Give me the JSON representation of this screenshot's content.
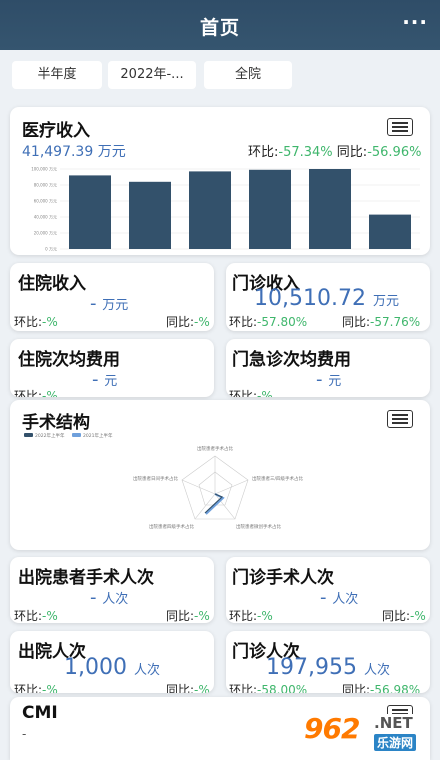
{
  "header": {
    "title": "首页",
    "more": "···"
  },
  "filters": {
    "period": "半年度",
    "year": "2022年-...",
    "scope": "全院"
  },
  "medical_income": {
    "title": "医疗收入",
    "value": "41,497.39",
    "unit": "万元",
    "hb_label": "环比:",
    "hb_value": "-57.34%",
    "tb_label": "同比:",
    "tb_value": "-56.96%"
  },
  "chart_data": {
    "type": "bar",
    "values": [
      92000,
      84000,
      97000,
      99000,
      100000,
      43000
    ],
    "ylim": [
      0,
      100000
    ],
    "y_ticks": [
      "100,000 万元",
      "80,000 万元",
      "60,000 万元",
      "40,000 万元",
      "20,000 万元",
      "0 万元"
    ],
    "grid": true
  },
  "inpatient_income": {
    "title": "住院收入",
    "value": "-",
    "unit": "万元",
    "hb_label": "环比:",
    "hb_value": "-%",
    "tb_label": "同比:",
    "tb_value": "-%"
  },
  "outpatient_income": {
    "title": "门诊收入",
    "value": "10,510.72",
    "unit": "万元",
    "hb_label": "环比:",
    "hb_value": "-57.80%",
    "tb_label": "同比:",
    "tb_value": "-57.76%"
  },
  "inpatient_avg_cost": {
    "title": "住院次均费用",
    "value": "-",
    "unit": "元",
    "hb_label": "环比:",
    "hb_value": "-%"
  },
  "emergency_avg_cost": {
    "title": "门急诊次均费用",
    "value": "-",
    "unit": "元",
    "hb_label": "环比:",
    "hb_value": "-%"
  },
  "surgery_structure": {
    "title": "手术结构",
    "legend": [
      "2022年上半年",
      "2021年上半年"
    ],
    "colors": {
      "series1": "#33516b",
      "series2": "#6fa0dc"
    },
    "axes": [
      "出院患者手术占比",
      "出院患者三/四级手术占比",
      "出院患者微创手术占比",
      "出院患者四级手术占比",
      "出院患者日间手术占比"
    ]
  },
  "discharged_surgery": {
    "title": "出院患者手术人次",
    "value": "-",
    "unit": "人次",
    "hb_label": "环比:",
    "hb_value": "-%",
    "tb_label": "同比:",
    "tb_value": "-%"
  },
  "outpatient_surgery": {
    "title": "门诊手术人次",
    "value": "-",
    "unit": "人次",
    "hb_label": "环比:",
    "hb_value": "-%",
    "tb_label": "同比:",
    "tb_value": "-%"
  },
  "discharges": {
    "title": "出院人次",
    "value": "1,000",
    "unit": "人次",
    "hb_label": "环比:",
    "hb_value": "-%",
    "tb_label": "同比:",
    "tb_value": "-%"
  },
  "outpatient_visits": {
    "title": "门诊人次",
    "value": "197,955",
    "unit": "人次",
    "hb_label": "环比:",
    "hb_value": "-58.00%",
    "tb_label": "同比:",
    "tb_value": "-56.98%"
  },
  "cmi": {
    "title": "CMI",
    "value": "-"
  },
  "watermark": {
    "number": "962",
    "net": ".NET",
    "site": "乐游网"
  }
}
